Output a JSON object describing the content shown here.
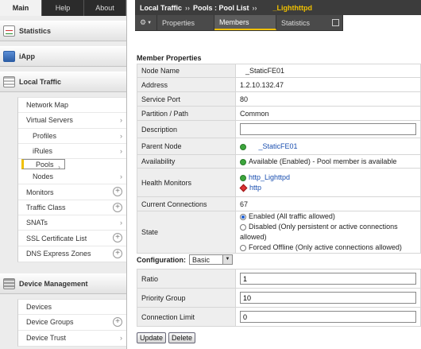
{
  "topnav": {
    "tabs": [
      "Main",
      "Help",
      "About"
    ],
    "active": "Main"
  },
  "sidebar": {
    "sections": {
      "statistics": "Statistics",
      "iapp": "iApp",
      "local_traffic": "Local Traffic",
      "device_management": "Device Management"
    },
    "local_traffic_items": [
      "Network Map",
      "Virtual Servers",
      "Profiles",
      "iRules",
      "Pools",
      "Nodes",
      "Monitors",
      "Traffic Class",
      "SNATs",
      "SSL Certificate List",
      "DNS Express Zones"
    ],
    "device_management_items": [
      "Devices",
      "Device Groups",
      "Device Trust"
    ]
  },
  "breadcrumb": {
    "section": "Local Traffic",
    "sep1": "››",
    "page": "Pools : Pool List",
    "sep2": "››",
    "current": "_Lighthttpd"
  },
  "tabs": {
    "properties": "Properties",
    "members": "Members",
    "statistics": "Statistics",
    "active": "Members"
  },
  "member_properties": {
    "title": "Member Properties",
    "rows": {
      "node_name": {
        "label": "Node Name",
        "value": "_StaticFE01"
      },
      "address": {
        "label": "Address",
        "value": "1.2.10.132.47"
      },
      "service_port": {
        "label": "Service Port",
        "value": "80"
      },
      "partition": {
        "label": "Partition / Path",
        "value": "Common"
      },
      "description": {
        "label": "Description",
        "value": ""
      },
      "parent_node": {
        "label": "Parent Node",
        "value": "_StaticFE01"
      },
      "availability": {
        "label": "Availability",
        "value": "Available (Enabled) - Pool member is available"
      },
      "health_monitors": {
        "label": "Health Monitors",
        "values": [
          "http_Lighttpd",
          "http"
        ]
      },
      "current_connections": {
        "label": "Current Connections",
        "value": "67"
      },
      "state": {
        "label": "State",
        "options": [
          "Enabled (All traffic allowed)",
          "Disabled (Only persistent or active connections allowed)",
          "Forced Offline (Only active connections allowed)"
        ],
        "selected": 0
      }
    }
  },
  "configuration": {
    "label": "Configuration:",
    "mode": "Basic",
    "rows": {
      "ratio": {
        "label": "Ratio",
        "value": "1"
      },
      "priority_group": {
        "label": "Priority Group",
        "value": "10"
      },
      "connection_limit": {
        "label": "Connection Limit",
        "value": "0"
      }
    }
  },
  "buttons": {
    "update": "Update",
    "delete": "Delete"
  },
  "colors": {
    "accent": "#f0c000",
    "status_green": "#3ca63c",
    "status_red": "#d33333",
    "link": "#1a4fb0"
  },
  "icons": [
    "gear-icon",
    "chevron-down-icon",
    "chevron-right-icon",
    "plus-circle-icon",
    "green-status-icon",
    "red-diamond-icon",
    "popout-icon"
  ]
}
